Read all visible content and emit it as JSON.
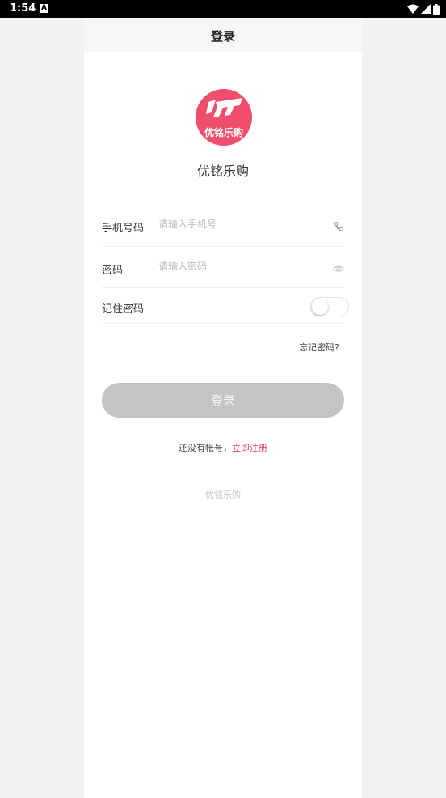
{
  "status_bar": {
    "time": "1:54",
    "notification_badge": "A",
    "icons": [
      "wifi-icon",
      "signal-icon",
      "battery-icon"
    ]
  },
  "header": {
    "title": "登录"
  },
  "brand": {
    "logo_text": "优铭乐购",
    "app_name": "优铭乐购",
    "accent_color": "#f04e6c"
  },
  "form": {
    "phone": {
      "label": "手机号码",
      "placeholder": "请输入手机号",
      "value": "",
      "icon": "phone-icon"
    },
    "password": {
      "label": "密码",
      "placeholder": "请输入密码",
      "value": "",
      "icon": "eye-icon"
    },
    "remember": {
      "label": "记住密码",
      "checked": false
    },
    "forgot_label": "忘记密码?",
    "submit_label": "登录",
    "submit_color": "#c4c4c4"
  },
  "register": {
    "prompt": "还没有帐号，",
    "link_label": "立即注册",
    "link_color": "#e6456a"
  },
  "footer": {
    "brand": "优铭乐购"
  }
}
